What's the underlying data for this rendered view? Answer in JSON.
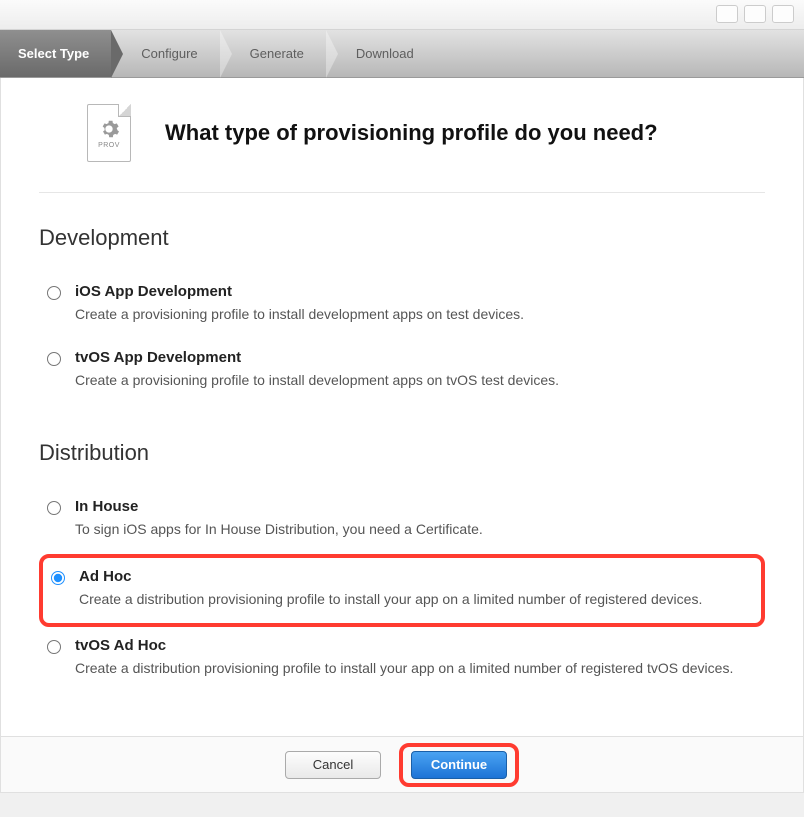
{
  "breadcrumb": {
    "steps": [
      "Select Type",
      "Configure",
      "Generate",
      "Download"
    ],
    "active_index": 0
  },
  "header": {
    "icon_label": "PROV",
    "title": "What type of provisioning profile do you need?"
  },
  "sections": [
    {
      "title": "Development",
      "options": [
        {
          "id": "ios-dev",
          "title": "iOS App Development",
          "desc": "Create a provisioning profile to install development apps on test devices.",
          "selected": false,
          "highlighted": false
        },
        {
          "id": "tvos-dev",
          "title": "tvOS App Development",
          "desc": "Create a provisioning profile to install development apps on tvOS test devices.",
          "selected": false,
          "highlighted": false
        }
      ]
    },
    {
      "title": "Distribution",
      "options": [
        {
          "id": "inhouse",
          "title": "In House",
          "desc": "To sign iOS apps for In House Distribution, you need a Certificate.",
          "selected": false,
          "highlighted": false
        },
        {
          "id": "adhoc",
          "title": "Ad Hoc",
          "desc": "Create a distribution provisioning profile to install your app on a limited number of registered devices.",
          "selected": true,
          "highlighted": true
        },
        {
          "id": "tvos-adhoc",
          "title": "tvOS Ad Hoc",
          "desc": "Create a distribution provisioning profile to install your app on a limited number of registered tvOS devices.",
          "selected": false,
          "highlighted": false
        }
      ]
    }
  ],
  "footer": {
    "cancel": "Cancel",
    "continue": "Continue"
  }
}
